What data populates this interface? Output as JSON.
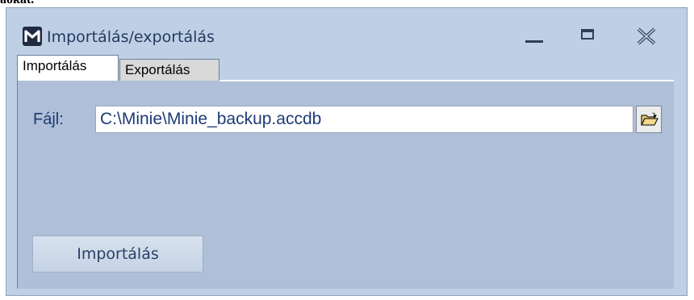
{
  "caption": "aokat.",
  "window": {
    "title": "Importálás/exportálás",
    "icon": "app-logo-icon",
    "controls": [
      "minimize-icon",
      "maximize-icon",
      "close-icon"
    ]
  },
  "tabs": [
    {
      "label": "Importálás",
      "active": true
    },
    {
      "label": "Exportálás",
      "active": false
    }
  ],
  "form": {
    "file_label": "Fájl:",
    "file_value": "C:\\Minie\\Minie_backup.accdb",
    "browse_icon": "open-folder-icon",
    "submit_label": "Importálás"
  },
  "colors": {
    "window_bg": "#bfd0e6",
    "panel_bg": "#aebfd7",
    "title_text": "#233a5e",
    "label_text": "#1d3b74"
  }
}
